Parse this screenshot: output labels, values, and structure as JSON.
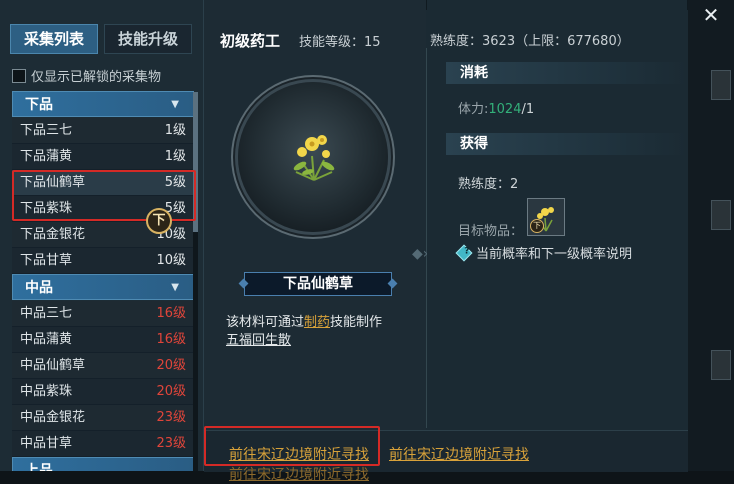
{
  "tabs": [
    {
      "label": "采集列表",
      "active": true
    },
    {
      "label": "技能升级",
      "active": false
    }
  ],
  "filter": {
    "label": "仅显示已解锁的采集物",
    "checked": false
  },
  "groups": [
    {
      "name": "下品",
      "items": [
        {
          "name": "下品三七",
          "level": "1级",
          "locked": false
        },
        {
          "name": "下品蒲黄",
          "level": "1级",
          "locked": false
        },
        {
          "name": "下品仙鹤草",
          "level": "5级",
          "locked": false,
          "selected": true
        },
        {
          "name": "下品紫珠",
          "level": "5级",
          "locked": false
        },
        {
          "name": "下品金银花",
          "level": "10级",
          "locked": false
        },
        {
          "name": "下品甘草",
          "level": "10级",
          "locked": false
        }
      ]
    },
    {
      "name": "中品",
      "items": [
        {
          "name": "中品三七",
          "level": "16级",
          "locked": true
        },
        {
          "name": "中品蒲黄",
          "level": "16级",
          "locked": true
        },
        {
          "name": "中品仙鹤草",
          "level": "20级",
          "locked": true
        },
        {
          "name": "中品紫珠",
          "level": "20级",
          "locked": true
        },
        {
          "name": "中品金银花",
          "level": "23级",
          "locked": true
        },
        {
          "name": "中品甘草",
          "level": "23级",
          "locked": true
        }
      ]
    },
    {
      "name": "上品",
      "items": []
    }
  ],
  "header": {
    "job_title": "初级药工",
    "skill_level": "技能等级：15",
    "proficiency": "熟练度：3623（上限：677680）"
  },
  "item": {
    "name": "下品仙鹤草",
    "grade_badge": "下",
    "desc_prefix": "该材料可通过",
    "desc_link": "制药",
    "desc_suffix": "技能制作",
    "desc_product": "五福回生散"
  },
  "consume": {
    "title": "消耗",
    "stamina_label": "体力:",
    "stamina_current": "1024",
    "stamina_sep": "/1"
  },
  "gain": {
    "title": "获得",
    "proficiency": "熟练度：2",
    "target_label": "目标物品：",
    "target_badge": "下",
    "probability_link": "当前概率和下一级概率说明",
    "probability_icon": "?"
  },
  "links": {
    "find1": "前往宋辽边境附近寻找",
    "find2": "前往宋辽边境附近寻找",
    "find3": "前往宋辽边境附近寻找"
  },
  "close_icon": "✕",
  "colors": {
    "accent": "#2d5f83",
    "link": "#d8a23a",
    "locked": "#e0453a",
    "stamina": "#33b07a",
    "highlight": "#d42a26"
  }
}
